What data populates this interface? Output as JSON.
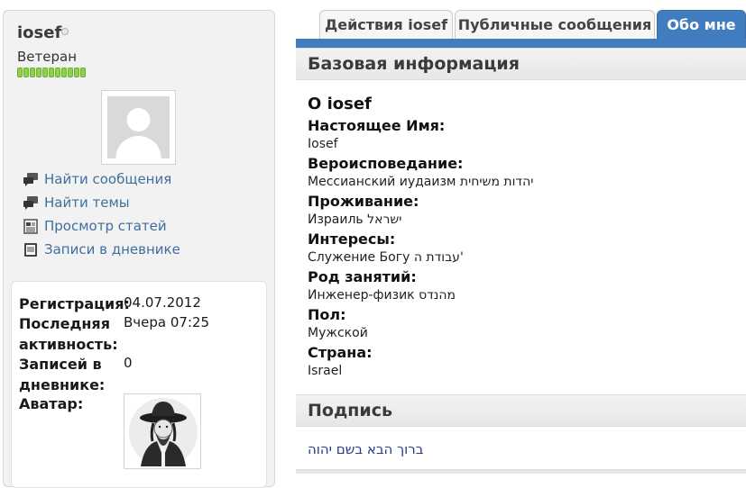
{
  "sidebar": {
    "username": "iosef",
    "rank": "Ветеран",
    "reputation_pips": 11,
    "links": [
      {
        "label": "Найти сообщения",
        "icon": "search-posts-icon"
      },
      {
        "label": "Найти темы",
        "icon": "search-threads-icon"
      },
      {
        "label": "Просмотр статей",
        "icon": "articles-icon"
      },
      {
        "label": "Записи в дневнике",
        "icon": "blog-icon"
      }
    ],
    "stats": {
      "registration_label": "Регистрация:",
      "registration_value": "04.07.2012",
      "last_activity_label_1": "Последняя",
      "last_activity_label_2": "активность:",
      "last_activity_value": "Вчера 07:25",
      "diary_label_1": "Записей в",
      "diary_label_2": "дневнике:",
      "diary_value": "0",
      "avatar_label": "Аватар:"
    }
  },
  "tabs": [
    {
      "label": "Действия iosef",
      "active": false
    },
    {
      "label": "Публичные сообщения",
      "active": false
    },
    {
      "label": "Обо мне",
      "active": true
    }
  ],
  "basic_info": {
    "header": "Базовая информация",
    "about_title": "О iosef",
    "fields": [
      {
        "label": "Настоящее Имя:",
        "value": "Iosef"
      },
      {
        "label": "Вероисповедание:",
        "value": "Мессианский иудаизм יהדות משיחית"
      },
      {
        "label": "Проживание:",
        "value": "Израиль ישראל"
      },
      {
        "label": "Интересы:",
        "value": "Служение Богу עבודת ה'"
      },
      {
        "label": "Род занятий:",
        "value": "Инженер-физик מהנדס"
      },
      {
        "label": "Пол:",
        "value": "Мужской"
      },
      {
        "label": "Страна:",
        "value": "Israel"
      }
    ]
  },
  "signature": {
    "header": "Подпись",
    "text": "ברוך הבא בשם יהוה"
  },
  "colors": {
    "accent": "#417cc0",
    "link": "#3e6f9e",
    "reputation": "#8ed24b"
  }
}
